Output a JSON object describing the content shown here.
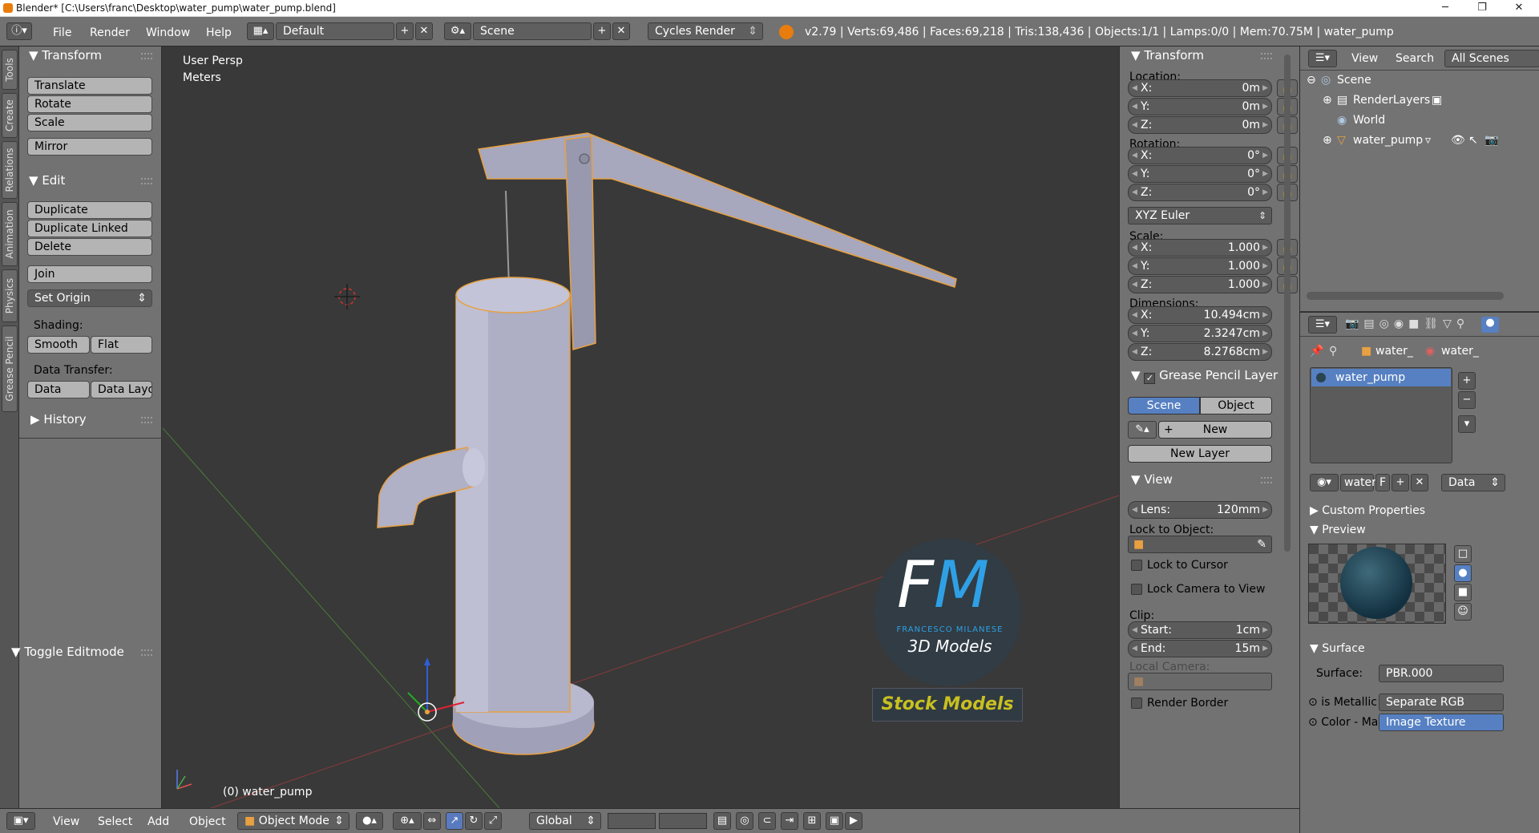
{
  "window": {
    "title": "Blender* [C:\\Users\\franc\\Desktop\\water_pump\\water_pump.blend]",
    "minimize": "─",
    "maximize": "❐",
    "close": "✕"
  },
  "infobar": {
    "menus": [
      "File",
      "Render",
      "Window",
      "Help"
    ],
    "layout": "Default",
    "scene": "Scene",
    "engine": "Cycles Render",
    "stats": "v2.79 | Verts:69,486 | Faces:69,218 | Tris:138,436 | Objects:1/1 | Lamps:0/0 | Mem:70.75M | water_pump"
  },
  "tabs": [
    "Tools",
    "Create",
    "Relations",
    "Animation",
    "Physics",
    "Grease Pencil"
  ],
  "toolshelf": {
    "transform": {
      "title": "Transform",
      "buttons": [
        "Translate",
        "Rotate",
        "Scale",
        "Mirror"
      ]
    },
    "edit": {
      "title": "Edit",
      "buttons": [
        "Duplicate",
        "Duplicate Linked",
        "Delete",
        "Join"
      ],
      "set_origin": "Set Origin",
      "shading_label": "Shading:",
      "smooth": "Smooth",
      "flat": "Flat",
      "data_transfer_label": "Data Transfer:",
      "data": "Data",
      "data_layout": "Data Layo"
    },
    "history": "History",
    "toggle_editmode": "Toggle Editmode"
  },
  "viewport": {
    "view_name": "User Persp",
    "units": "Meters",
    "object_label": "(0) water_pump",
    "watermark": {
      "initials": "FM",
      "author": "FRANCESCO MILANESE",
      "subtitle": "3D Models",
      "banner": "Stock Models"
    }
  },
  "vpbar": {
    "menus": [
      "View",
      "Select",
      "Add",
      "Object"
    ],
    "mode": "Object Mode",
    "orientation": "Global"
  },
  "npanel": {
    "transform_title": "Transform",
    "location_label": "Location:",
    "location": [
      {
        "k": "X:",
        "v": "0m"
      },
      {
        "k": "Y:",
        "v": "0m"
      },
      {
        "k": "Z:",
        "v": "0m"
      }
    ],
    "rotation_label": "Rotation:",
    "rotation": [
      {
        "k": "X:",
        "v": "0°"
      },
      {
        "k": "Y:",
        "v": "0°"
      },
      {
        "k": "Z:",
        "v": "0°"
      }
    ],
    "rotation_mode": "XYZ Euler",
    "scale_label": "Scale:",
    "scale": [
      {
        "k": "X:",
        "v": "1.000"
      },
      {
        "k": "Y:",
        "v": "1.000"
      },
      {
        "k": "Z:",
        "v": "1.000"
      }
    ],
    "dimensions_label": "Dimensions:",
    "dimensions": [
      {
        "k": "X:",
        "v": "10.494cm"
      },
      {
        "k": "Y:",
        "v": "2.3247cm"
      },
      {
        "k": "Z:",
        "v": "8.2768cm"
      }
    ],
    "gp_title": "Grease Pencil Layer",
    "gp_scene": "Scene",
    "gp_object": "Object",
    "gp_new": "New",
    "gp_new_layer": "New Layer",
    "view_title": "View",
    "lens_label": "Lens:",
    "lens_value": "120mm",
    "lock_to_object": "Lock to Object:",
    "lock_to_cursor": "Lock to Cursor",
    "lock_camera": "Lock Camera to View",
    "clip_label": "Clip:",
    "clip_start_k": "Start:",
    "clip_start_v": "1cm",
    "clip_end_k": "End:",
    "clip_end_v": "15m",
    "local_camera": "Local Camera:",
    "render_border": "Render Border"
  },
  "outliner": {
    "view": "View",
    "search": "Search",
    "filter": "All Scenes",
    "items": [
      "Scene",
      "RenderLayers",
      "World",
      "water_pump"
    ]
  },
  "properties": {
    "crumb_object": "water_",
    "crumb_material": "water_",
    "material_slot": "water_pump",
    "mat_name": "water",
    "mat_fake": "F",
    "mat_link": "Data",
    "custom_props": "Custom Properties",
    "preview": "Preview",
    "surface_title": "Surface",
    "surface_label": "Surface:",
    "surface_value": "PBR.000",
    "metallic_label": "is Metallic",
    "metallic_value": "Separate RGB",
    "color_label": "Color - Ma",
    "color_value": "Image Texture"
  },
  "colors": {
    "accent": "#5680c2",
    "selection": "#f5a623",
    "bg_viewport": "#393939",
    "panel": "#727272"
  }
}
